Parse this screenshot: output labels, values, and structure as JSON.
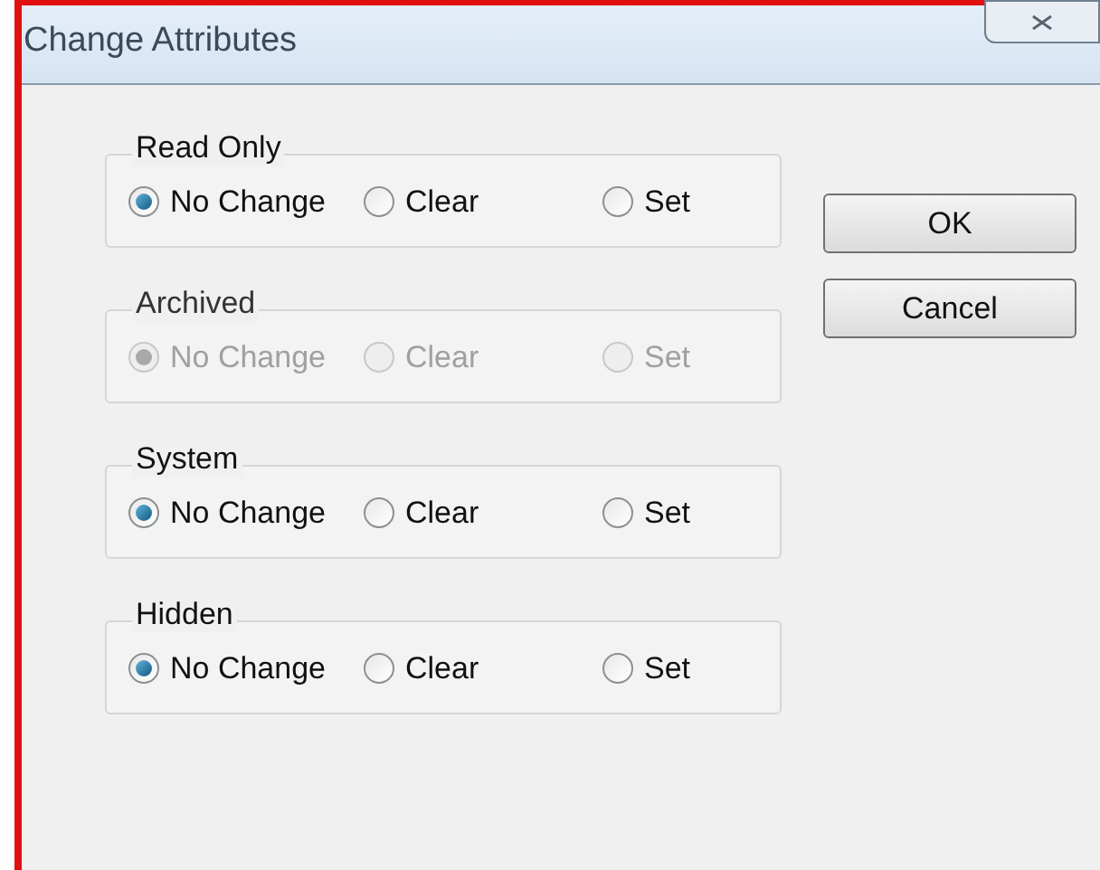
{
  "window": {
    "title": "Change Attributes"
  },
  "groups": [
    {
      "label": "Read Only",
      "disabled": false,
      "options": [
        {
          "label": "No Change",
          "selected": true
        },
        {
          "label": "Clear",
          "selected": false
        },
        {
          "label": "Set",
          "selected": false
        }
      ]
    },
    {
      "label": "Archived",
      "disabled": true,
      "options": [
        {
          "label": "No Change",
          "selected": true
        },
        {
          "label": "Clear",
          "selected": false
        },
        {
          "label": "Set",
          "selected": false
        }
      ]
    },
    {
      "label": "System",
      "disabled": false,
      "options": [
        {
          "label": "No Change",
          "selected": true
        },
        {
          "label": "Clear",
          "selected": false
        },
        {
          "label": "Set",
          "selected": false
        }
      ]
    },
    {
      "label": "Hidden",
      "disabled": false,
      "options": [
        {
          "label": "No Change",
          "selected": true
        },
        {
          "label": "Clear",
          "selected": false
        },
        {
          "label": "Set",
          "selected": false
        }
      ]
    }
  ],
  "buttons": [
    "OK",
    "Cancel"
  ]
}
